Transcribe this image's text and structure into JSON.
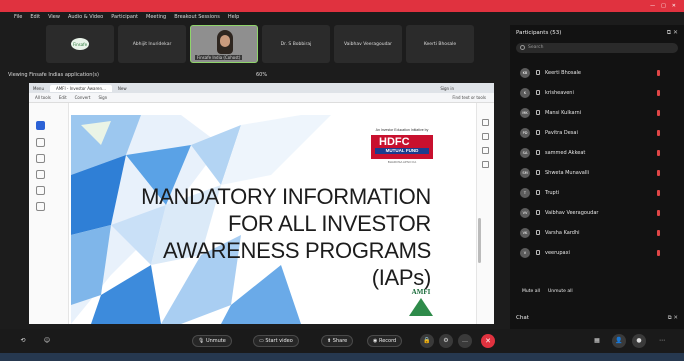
{
  "menu": [
    "File",
    "Edit",
    "View",
    "Audio & Video",
    "Participant",
    "Meeting",
    "Breakout Sessions",
    "Help"
  ],
  "topbar": {
    "right": [
      "—",
      "□",
      "✕"
    ]
  },
  "video": {
    "thumbs": [
      {
        "type": "logo",
        "label": "Finsafe"
      },
      {
        "type": "name",
        "label": "Abhijit Inuridekar"
      },
      {
        "type": "video",
        "label": "Finsafe India (Cohost)"
      },
      {
        "type": "name",
        "label": "Dr. S Bobbiraj"
      },
      {
        "type": "name",
        "label": "Vaibhav Veeragoudar"
      },
      {
        "type": "name",
        "label": "Keerti Bhosale"
      }
    ],
    "viewing_label": "Viewing Finsafe Indias application(s)",
    "zoom": "60%"
  },
  "browser": {
    "tabs": [
      "Menu",
      "AMFI - Investor Awaren...",
      "New"
    ],
    "toolbar": [
      "All tools",
      "Edit",
      "Convert",
      "Sign"
    ],
    "toolbar_right": "Find text or tools",
    "signin": "Sign in"
  },
  "slide": {
    "title_lines": [
      "MANDATORY INFORMATION",
      "FOR ALL INVESTOR",
      "AWARENESS PROGRAMS",
      "(IAPs)"
    ],
    "hdfc": {
      "top": "An Investor Education Initiative by",
      "big": "HDFC",
      "small": "MUTUAL FUND",
      "tag": "BHAROSA APNO KA"
    },
    "amfi": "AMFI"
  },
  "participants": {
    "title": "Participants (53)",
    "search_placeholder": "Search",
    "list": [
      {
        "initials": "KB",
        "name": "Keerti Bhosale"
      },
      {
        "initials": "K",
        "name": "krisheaveni"
      },
      {
        "initials": "MK",
        "name": "Mansi Kulkarni"
      },
      {
        "initials": "PD",
        "name": "Pavitra Desai"
      },
      {
        "initials": "SA",
        "name": "sammed Akkeat"
      },
      {
        "initials": "SM",
        "name": "Shweta Munavalli"
      },
      {
        "initials": "T",
        "name": "Trupti"
      },
      {
        "initials": "VV",
        "name": "Vaibhav Veeragoudar"
      },
      {
        "initials": "VK",
        "name": "Varsha Kardhi"
      },
      {
        "initials": "V",
        "name": "veerupaxi"
      }
    ],
    "mute_all": "Mute all",
    "unmute_all": "Unmute all"
  },
  "chat": {
    "title": "Chat"
  },
  "bottom": {
    "unmute": "Unmute",
    "start_video": "Start video",
    "share": "Share",
    "record": "Record"
  },
  "colors": {
    "accent": "#e0323f",
    "hdfc_red": "#c8102e",
    "hdfc_blue": "#1b3c8f",
    "slide_blue": "#2f7fd6"
  }
}
